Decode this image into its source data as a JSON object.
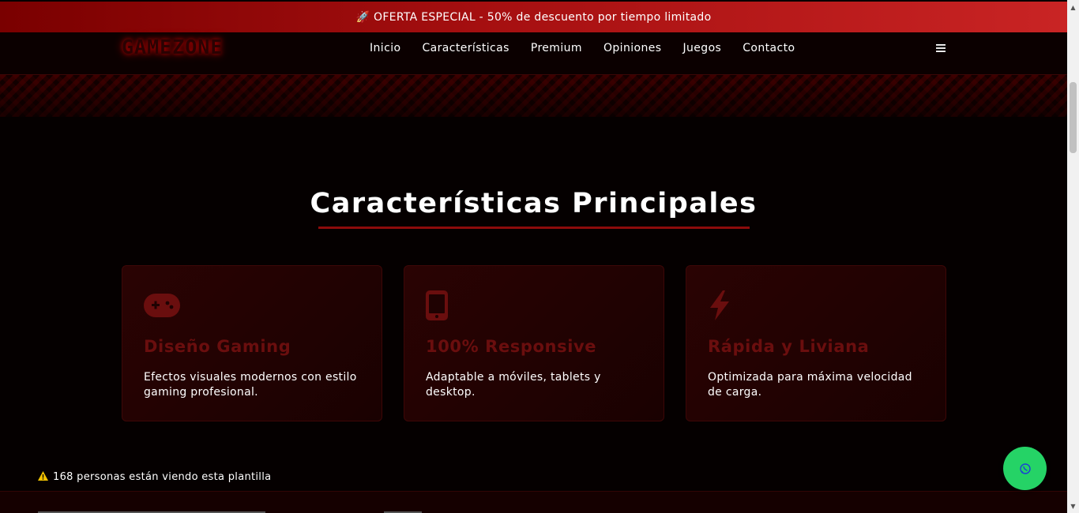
{
  "promo": {
    "icon": "rocket-icon",
    "text": "🚀 OFERTA ESPECIAL - 50% de descuento por tiempo limitado"
  },
  "nav": {
    "logo": "GAMEZONE",
    "items": [
      "Inicio",
      "Características",
      "Premium",
      "Opiniones",
      "Juegos",
      "Contacto"
    ],
    "menu_icon": "hamburger-icon"
  },
  "features": {
    "title": "Características Principales",
    "cards": [
      {
        "icon": "gamepad-icon",
        "title": "Diseño Gaming",
        "desc": "Efectos visuales modernos con estilo gaming profesional."
      },
      {
        "icon": "mobile-icon",
        "title": "100% Responsive",
        "desc": "Adaptable a móviles, tablets y desktop."
      },
      {
        "icon": "bolt-icon",
        "title": "Rápida y Liviana",
        "desc": "Optimizada para máxima velocidad de carga."
      }
    ]
  },
  "viewers": {
    "icon": "warning-icon",
    "text": "168 personas están viendo esta plantilla"
  },
  "whatsapp": {
    "icon": "whatsapp-icon"
  },
  "colors": {
    "accent": "#8c0b0b",
    "promo_start": "#7a0000",
    "promo_end": "#c92424",
    "whatsapp": "#25d366",
    "card_title": "#6a0e0e"
  }
}
